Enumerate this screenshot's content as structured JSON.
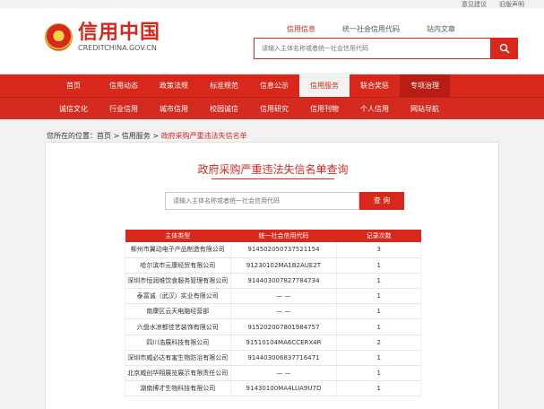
{
  "util_links": [
    "意见建议",
    "旧版声明"
  ],
  "logo": {
    "cn": "信用中国",
    "en": "CREDITCHINA.GOV.CN"
  },
  "search_tabs": [
    "信用信息",
    "统一社会信用代码",
    "站内文章"
  ],
  "search": {
    "placeholder": "请输入主体名称或者统一社会信用代码"
  },
  "nav": {
    "row1": [
      "首页",
      "信用动态",
      "政策法规",
      "标准规范",
      "信息公示",
      "信用服务",
      "联合奖惩",
      "专项治理"
    ],
    "row2": [
      "诚信文化",
      "行业信用",
      "城市信用",
      "校园诚信",
      "信用研究",
      "信用刊物",
      "个人信用",
      "网站导航"
    ]
  },
  "breadcrumb": {
    "prefix": "您所在的位置：",
    "home": "首页",
    "sep1": ">",
    "section": "信用服务",
    "sep2": ">",
    "current": "政府采购严重违法失信名单"
  },
  "panel": {
    "title": "政府采购严重违法失信名单查询",
    "search_placeholder": "请输入主体名称或者统一社会信用代码",
    "query_label": "查 询"
  },
  "table": {
    "headers": [
      "主体类型",
      "统一社会信用代码",
      "记录次数"
    ],
    "rows": [
      [
        "柳州市翼动电子产品制造有限公司",
        "914502050737521154",
        "3"
      ],
      [
        "哈尔滨市元康经贸有限公司",
        "91230102MA1B2AUE2T",
        "1"
      ],
      [
        "深圳市恒润维饮食服务管理有限公司",
        "914403007827784734",
        "1"
      ],
      [
        "泰富诚（武汉）实业有限公司",
        "— —",
        "1"
      ],
      [
        "南康区云天电脑经营部",
        "— —",
        "1"
      ],
      [
        "六盘水凉都佳艺装饰有限公司",
        "915202007801984757",
        "1"
      ],
      [
        "四川浩展科技有限公司",
        "91510104MA6CCERX4R",
        "2"
      ],
      [
        "深圳市威必达有害生物防治有限公司",
        "914403006837716471",
        "1"
      ],
      [
        "北京威创华翔展览展示有限责任公司",
        "— —",
        "1"
      ],
      [
        "湖南博才生物科技有限公司",
        "91430100MA4LUA9U7D",
        "1"
      ]
    ]
  },
  "colors": {
    "brand_red": "#d8281c"
  }
}
